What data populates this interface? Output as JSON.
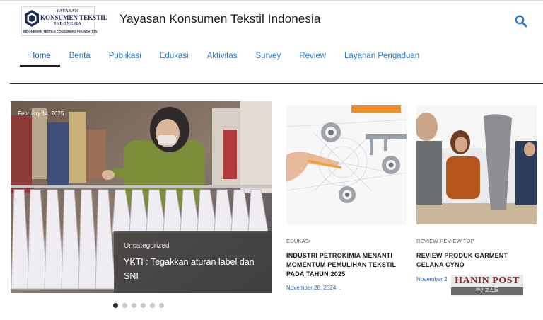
{
  "header": {
    "logo": {
      "line_top": "YAYASAN",
      "line_main": "KONSUMEN TEKSTIL",
      "line_sub": "INDONESIA",
      "line_foot": "INDONESIAN TEXTILE CONSUMERS FOUNDATION"
    },
    "site_title": "Yayasan Konsumen Tekstil Indonesia",
    "search_icon": "search-icon",
    "accent_color": "#2b7cd3"
  },
  "nav": {
    "items": [
      "Home",
      "Berita",
      "Publikasi",
      "Edukasi",
      "Aktivitas",
      "Survey",
      "Review",
      "Layanan Pengaduan"
    ],
    "active": "Home"
  },
  "hero": {
    "date": "February 14, 2025",
    "category": "Uncategorized",
    "title": "YKTI : Tegakkan aturan label dan SNI",
    "slider_dots": 6,
    "active_dot": 1
  },
  "cards": [
    {
      "category": "EDUKASI",
      "title": "INDUSTRI PETROKIMIA MENANTI MOMENTUM PEMULIHAN TEKSTIL PADA TAHUN 2025",
      "date": "November 28, 2024",
      "suffix": "."
    },
    {
      "category": "REVIEW  REVIEW TOP",
      "title": "REVIEW PRODUK GARMENT CELANA CYNO",
      "date": "November 2"
    }
  ],
  "watermark": {
    "main": "HANIN POST",
    "sub": "한인포스트"
  }
}
